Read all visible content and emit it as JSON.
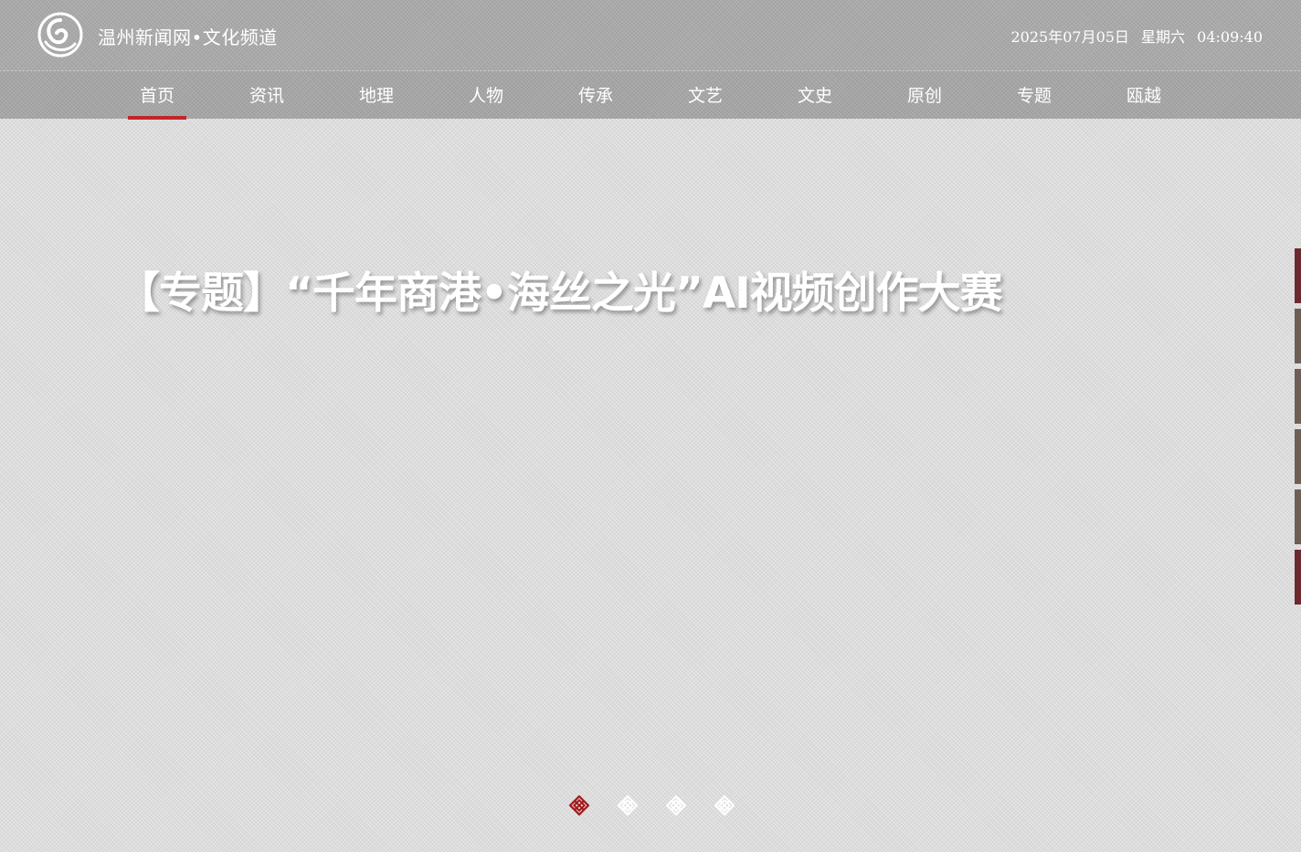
{
  "header": {
    "site_title": "温州新闻网•文化频道",
    "date": "2025年07月05日",
    "weekday": "星期六",
    "time": "04:09:40",
    "logo_icon": "swirl-logo-icon"
  },
  "nav": {
    "items": [
      {
        "label": "首页",
        "active": true
      },
      {
        "label": "资讯"
      },
      {
        "label": "地理"
      },
      {
        "label": "人物"
      },
      {
        "label": "传承"
      },
      {
        "label": "文艺"
      },
      {
        "label": "文史"
      },
      {
        "label": "原创"
      },
      {
        "label": "专题"
      },
      {
        "label": "瓯越"
      }
    ]
  },
  "hero": {
    "title": "【专题】“千年商港•海丝之光”AI视频创作大赛"
  },
  "slider": {
    "active_index": 0,
    "dot_icon": "chinese-knot-icon",
    "dot_count": 4
  },
  "side_tabs": {
    "count": 6
  },
  "colors": {
    "accent": "#c0262b",
    "knot_active": "#a3181c",
    "knot_inactive": "#ffffff",
    "side_tab_red": "#6b2a2e",
    "side_tab_brown": "#6d5f55"
  }
}
